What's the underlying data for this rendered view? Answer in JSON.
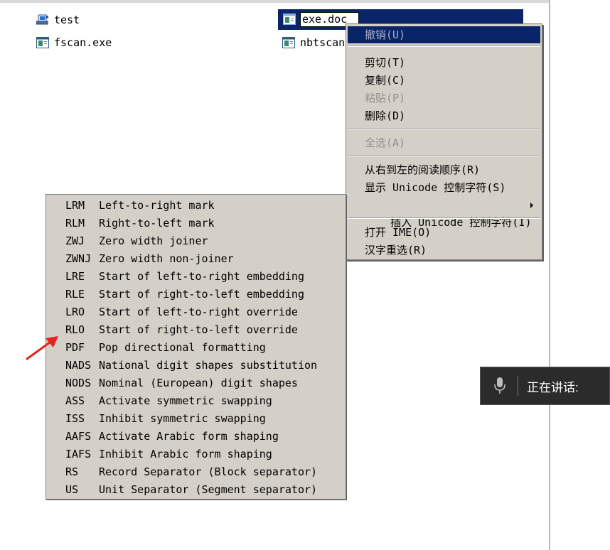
{
  "files": [
    {
      "label": "test",
      "icon": "user-folder-icon"
    },
    {
      "label": "fscan.exe",
      "icon": "app-window-icon"
    },
    {
      "label": "nbtscan",
      "icon": "app-window-icon"
    }
  ],
  "rename": {
    "value": "exe.doc",
    "selected_part": "exe.doc",
    "icon": "app-window-icon"
  },
  "context_menu": {
    "items": [
      {
        "label": "撤销(U)",
        "state": "disabled-highlighted"
      },
      {
        "label": "剪切(T)",
        "state": "enabled"
      },
      {
        "label": "复制(C)",
        "state": "enabled"
      },
      {
        "label": "粘贴(P)",
        "state": "disabled"
      },
      {
        "label": "删除(D)",
        "state": "enabled"
      },
      {
        "label": "全选(A)",
        "state": "disabled"
      },
      {
        "label": "从右到左的阅读顺序(R)",
        "state": "enabled"
      },
      {
        "label": "显示 Unicode 控制字符(S)",
        "state": "enabled"
      },
      {
        "label": "插入 Unicode 控制字符(I)",
        "state": "enabled",
        "submenu": true
      },
      {
        "label": "打开 IME(O)",
        "state": "enabled"
      },
      {
        "label": "汉字重选(R)",
        "state": "enabled"
      }
    ]
  },
  "unicode_menu": {
    "items": [
      {
        "code": "LRM",
        "desc": "Left-to-right mark"
      },
      {
        "code": "RLM",
        "desc": "Right-to-left mark"
      },
      {
        "code": "ZWJ",
        "desc": "Zero width joiner"
      },
      {
        "code": "ZWNJ",
        "desc": "Zero width non-joiner"
      },
      {
        "code": "LRE",
        "desc": "Start of left-to-right embedding"
      },
      {
        "code": "RLE",
        "desc": "Start of right-to-left embedding"
      },
      {
        "code": "LRO",
        "desc": "Start of left-to-right override"
      },
      {
        "code": "RLO",
        "desc": "Start of right-to-left override"
      },
      {
        "code": "PDF",
        "desc": "Pop directional formatting"
      },
      {
        "code": "NADS",
        "desc": "National digit shapes substitution"
      },
      {
        "code": "NODS",
        "desc": "Nominal (European) digit shapes"
      },
      {
        "code": "ASS",
        "desc": "Activate symmetric swapping"
      },
      {
        "code": "ISS",
        "desc": "Inhibit symmetric swapping"
      },
      {
        "code": "AAFS",
        "desc": "Activate Arabic form shaping"
      },
      {
        "code": "IAFS",
        "desc": "Inhibit Arabic form shaping"
      },
      {
        "code": "RS",
        "desc": "Record Separator (Block separator)"
      },
      {
        "code": "US",
        "desc": "Unit Separator (Segment separator)"
      }
    ]
  },
  "annotation": {
    "icon": "red-arrow-icon",
    "color": "#e8231f"
  },
  "voice_tooltip": {
    "label": "正在讲话:",
    "icon": "microphone-icon"
  },
  "colors": {
    "selection": "#0a246a",
    "menu_bg": "#d4d0c8",
    "disabled_text": "#8f8f8f"
  }
}
